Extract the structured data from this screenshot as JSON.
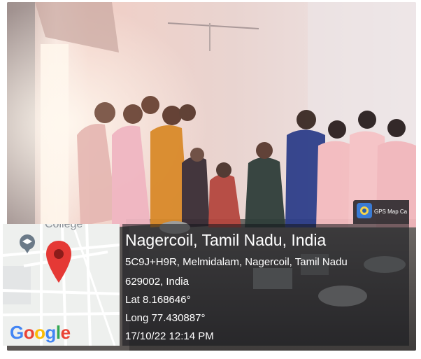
{
  "overlay": {
    "title": "Nagercoil, Tamil Nadu, India",
    "address_line1": "5C9J+H9R, Melmidalam, Nagercoil, Tamil Nadu",
    "address_line2": "629002, India",
    "latitude": "Lat 8.168646°",
    "longitude": "Long 77.430887°",
    "timestamp": "17/10/22 12:14 PM"
  },
  "map": {
    "place_label": "College",
    "logo_text": [
      "G",
      "o",
      "o",
      "g",
      "l",
      "e"
    ],
    "logo_colors": [
      "#4285f4",
      "#ea4335",
      "#fbbc05",
      "#4285f4",
      "#34a853",
      "#ea4335"
    ],
    "pin_color": "#e53935"
  },
  "badge": {
    "app_name": "GPS Map Ca",
    "icon": "gps-map-camera-icon"
  }
}
